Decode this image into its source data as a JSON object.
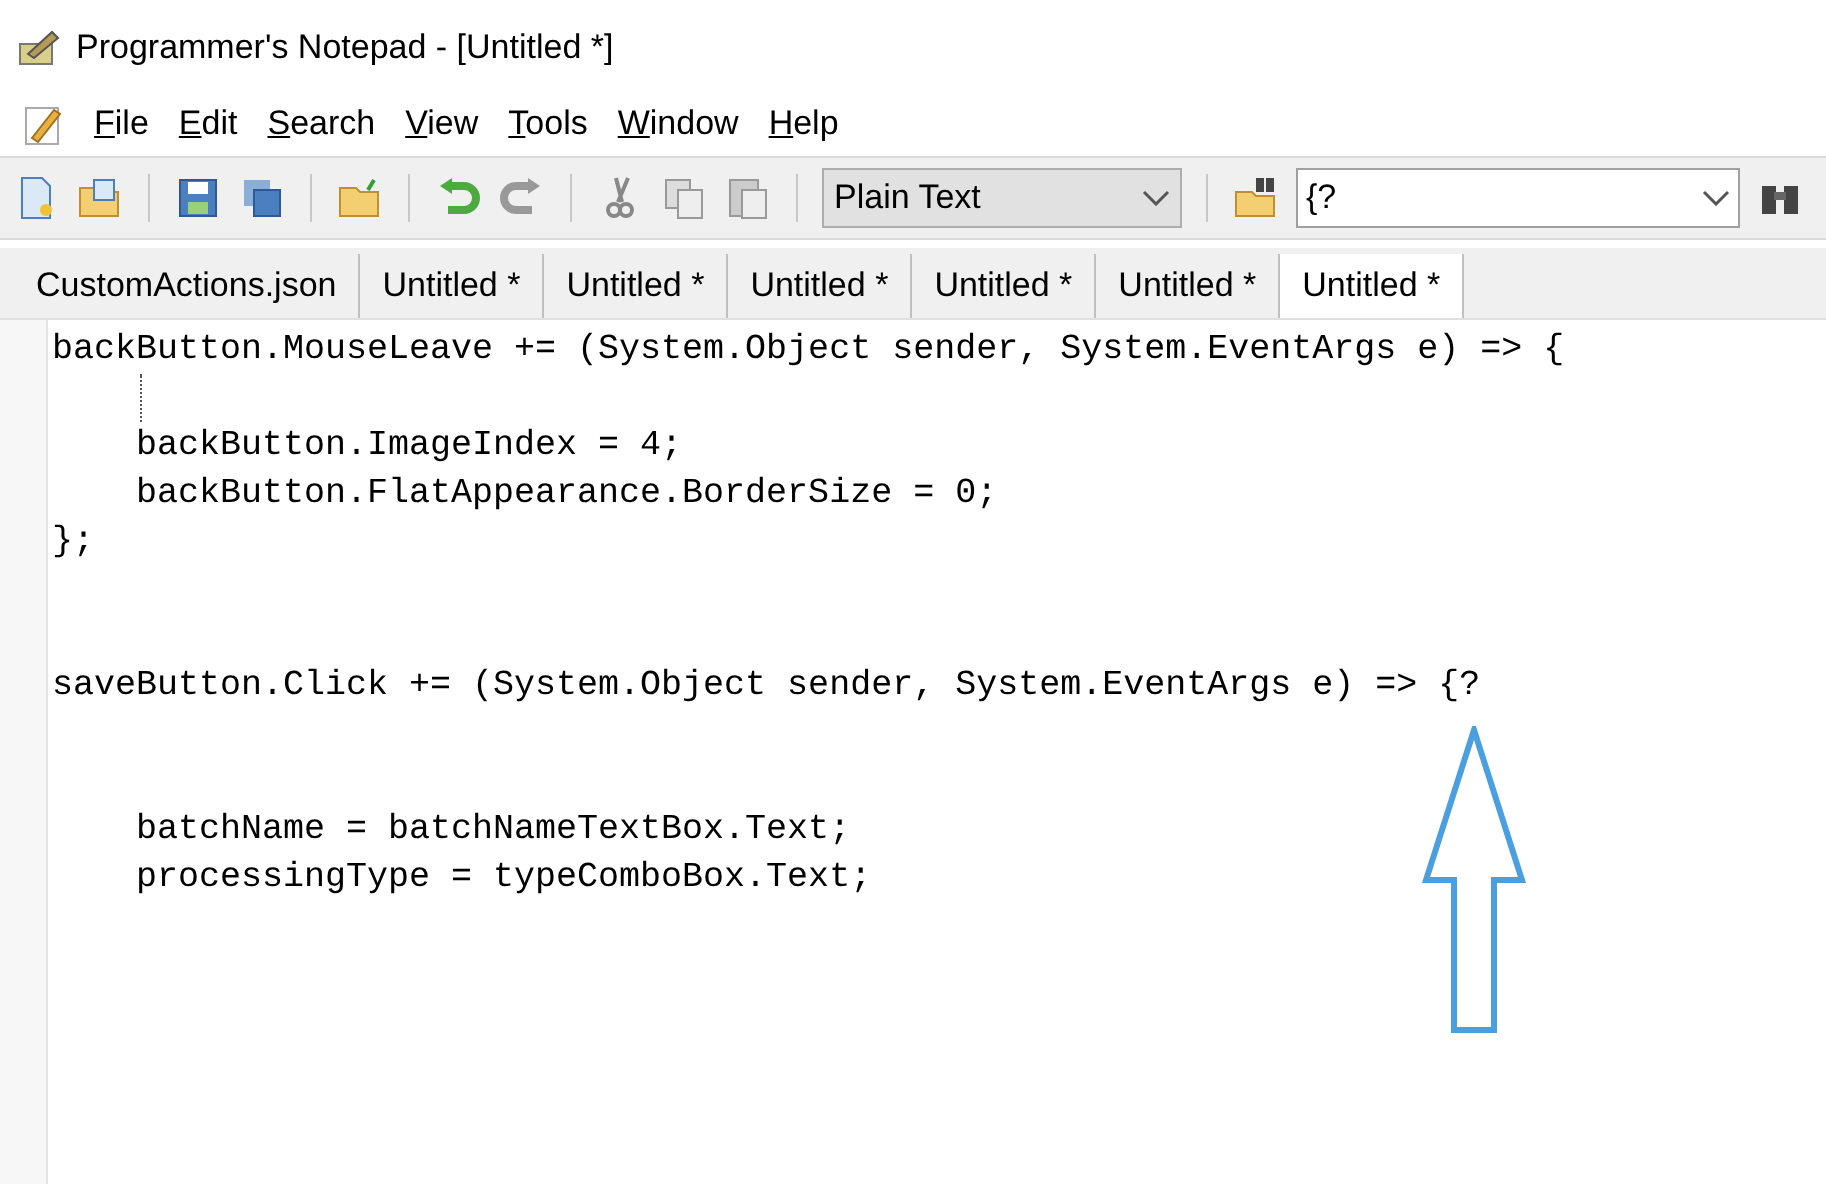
{
  "window": {
    "title": "Programmer's Notepad - [Untitled *]"
  },
  "menu": [
    "File",
    "Edit",
    "Search",
    "View",
    "Tools",
    "Window",
    "Help"
  ],
  "toolbar": {
    "scheme": "Plain Text",
    "find": "{?"
  },
  "tabs": [
    {
      "label": "CustomActions.json",
      "selected": false
    },
    {
      "label": "Untitled *",
      "selected": false
    },
    {
      "label": "Untitled *",
      "selected": false
    },
    {
      "label": "Untitled *",
      "selected": false
    },
    {
      "label": "Untitled *",
      "selected": false
    },
    {
      "label": "Untitled *",
      "selected": false
    },
    {
      "label": "Untitled *",
      "selected": true
    }
  ],
  "editor": {
    "lines": [
      {
        "kind": "code",
        "text": "backButton.MouseLeave += (System.Object sender, System.EventArgs e) => {"
      },
      {
        "kind": "guide"
      },
      {
        "kind": "code",
        "text": "    backButton.ImageIndex = 4;"
      },
      {
        "kind": "code",
        "text": "    backButton.FlatAppearance.BorderSize = 0;"
      },
      {
        "kind": "code",
        "text": "};"
      },
      {
        "kind": "blank"
      },
      {
        "kind": "blank"
      },
      {
        "kind": "code",
        "text": "saveButton.Click += (System.Object sender, System.EventArgs e) => {?"
      },
      {
        "kind": "blank"
      },
      {
        "kind": "blank"
      },
      {
        "kind": "code",
        "text": "    batchName = batchNameTextBox.Text;"
      },
      {
        "kind": "code",
        "text": "    processingType = typeComboBox.Text;"
      }
    ]
  }
}
